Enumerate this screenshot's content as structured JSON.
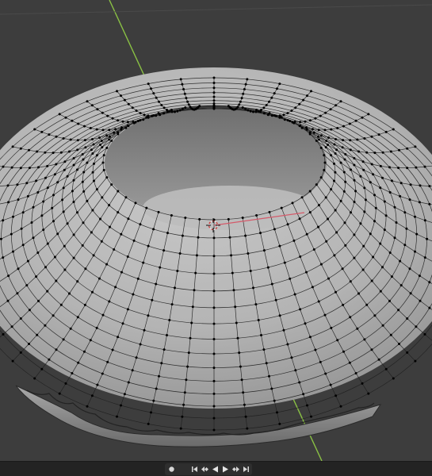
{
  "app": {
    "name": "3D Viewport"
  },
  "viewport": {
    "background": "#3d3d3d",
    "object": "torus",
    "mode": "edit-mode-vertex-select",
    "mesh_color": "#b4b4b4",
    "vertex_color": "#000000",
    "axis_y_color": "#8ac144",
    "axis_x_color": "#d45a6a",
    "cursor_icon": "3d-cursor-icon"
  },
  "timeline": {
    "controls": [
      {
        "name": "auto-keying-record",
        "icon": "record-dot-icon",
        "interactable": true
      },
      {
        "name": "jump-to-start",
        "icon": "jump-to-start-icon",
        "interactable": true
      },
      {
        "name": "jump-to-previous-keyframe",
        "icon": "previous-keyframe-icon",
        "interactable": true
      },
      {
        "name": "play-reverse",
        "icon": "play-reverse-icon",
        "interactable": true
      },
      {
        "name": "play",
        "icon": "play-icon",
        "interactable": true
      },
      {
        "name": "jump-to-next-keyframe",
        "icon": "next-keyframe-icon",
        "interactable": true
      },
      {
        "name": "jump-to-end",
        "icon": "jump-to-end-icon",
        "interactable": true
      }
    ]
  }
}
